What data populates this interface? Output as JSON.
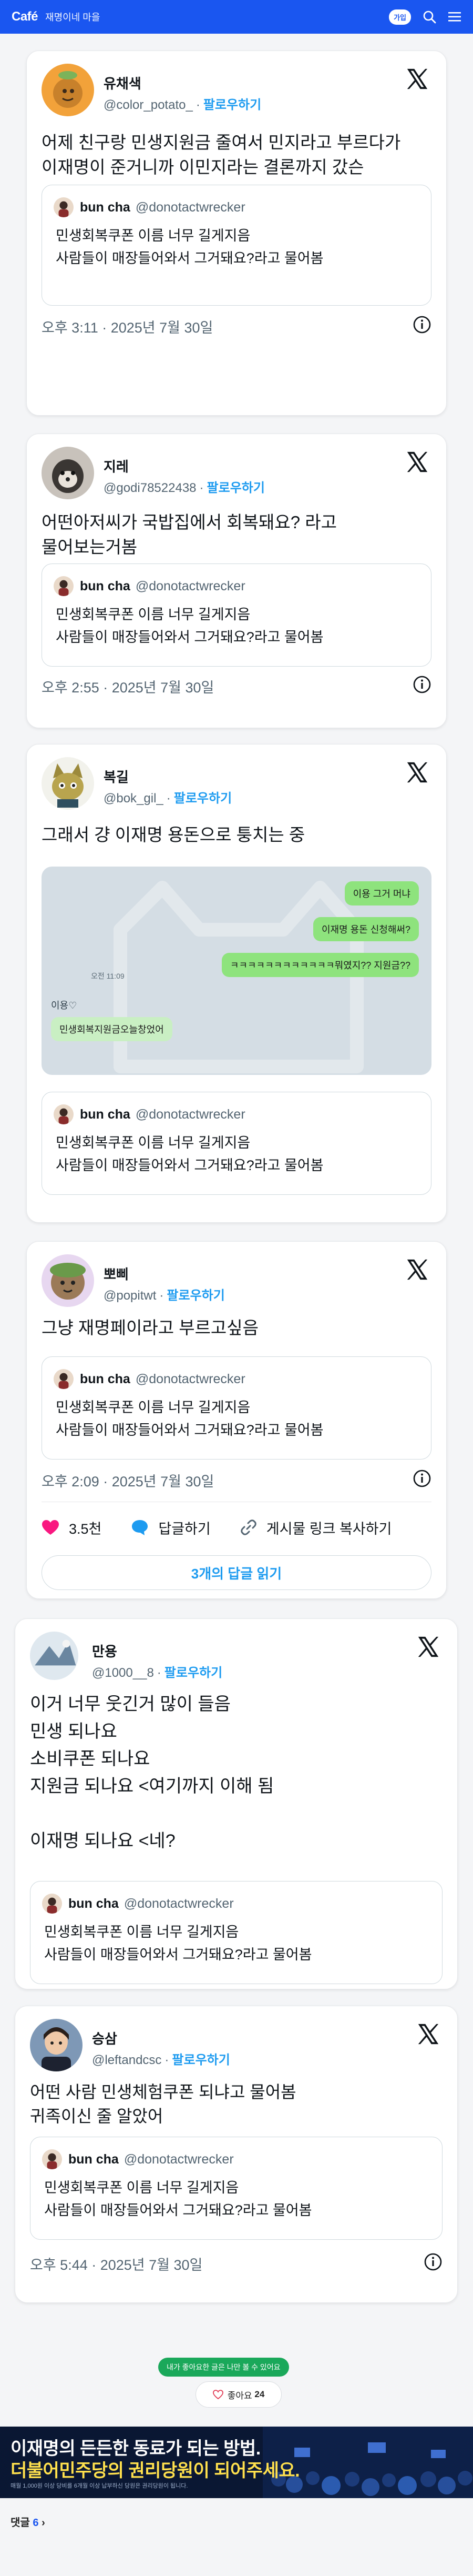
{
  "topbar": {
    "logo": "Café",
    "cafe_name": "재명이네 마을",
    "join_label": "가입"
  },
  "posts": [
    {
      "name": "유채색",
      "handle": "@color_potato_",
      "dot": "·",
      "follow": "팔로우하기",
      "lines": [
        "어제 친구랑 민생지원금 줄여서 민지라고 부르다가",
        "이재명이 준거니까 이민지라는 결론까지 갔슨"
      ],
      "quote": {
        "name": "bun cha",
        "handle": "@donotactwrecker",
        "lines": [
          "민생회복쿠폰 이름 너무 길게지음",
          "사람들이 매장들어와서 그거돼요?라고 물어봄"
        ]
      },
      "meta": "오후 3:11 · 2025년 7월 30일"
    },
    {
      "name": "지레",
      "handle": "@godi78522438",
      "dot": "·",
      "follow": "팔로우하기",
      "lines": [
        "어떤아저씨가 국밥집에서 회복돼요? 라고",
        "물어보는거봄"
      ],
      "quote": {
        "name": "bun cha",
        "handle": "@donotactwrecker",
        "lines": [
          "민생회복쿠폰 이름 너무 길게지음",
          "사람들이 매장들어와서 그거돼요?라고 물어봄"
        ]
      },
      "meta": "오후 2:55 · 2025년 7월 30일"
    },
    {
      "name": "복길",
      "handle": "@bok_gil_",
      "dot": "·",
      "follow": "팔로우하기",
      "lines": [
        "그래서 걍 이재명 용돈으로 퉁치는 중"
      ],
      "chat": {
        "me": [
          "이용 그거 머냐",
          "이재명 용돈 신청해써?",
          "ㅋㅋㅋㅋㅋㅋㅋㅋㅋㅋㅋㅋ뭐였지?? 지원금??"
        ],
        "time": "오전 11:09",
        "sender": "이용♡",
        "you": "민생회복지원금오늘창었어"
      },
      "quote": {
        "name": "bun cha",
        "handle": "@donotactwrecker",
        "lines": [
          "민생회복쿠폰 이름 너무 길게지음",
          "사람들이 매장들어와서 그거돼요?라고 물어봄"
        ]
      }
    },
    {
      "name": "뽀삐",
      "handle": "@popitwt",
      "dot": "·",
      "follow": "팔로우하기",
      "lines": [
        "그냥 재명페이라고 부르고싶음"
      ],
      "quote": {
        "name": "bun cha",
        "handle": "@donotactwrecker",
        "lines": [
          "민생회복쿠폰 이름 너무 길게지음",
          "사람들이 매장들어와서 그거돼요?라고 물어봄"
        ]
      },
      "meta": "오후 2:09 · 2025년 7월 30일",
      "actions": {
        "likes": "3.5천",
        "reply": "답글하기",
        "copy": "게시물 링크 복사하기"
      },
      "read_replies": "3개의 답글 읽기"
    },
    {
      "name": "만용",
      "handle": "@1000__8",
      "dot": "·",
      "follow": "팔로우하기",
      "lines": [
        "이거 너무 웃긴거 많이 들음",
        "민생 되나요",
        "소비쿠폰 되나요",
        "지원금 되나요 <여기까지 이해 됨",
        "",
        "이재명 되나요 <네?"
      ],
      "quote": {
        "name": "bun cha",
        "handle": "@donotactwrecker",
        "lines": [
          "민생회복쿠폰 이름 너무 길게지음",
          "사람들이 매장들어와서 그거돼요?라고 물어봄"
        ]
      }
    },
    {
      "name": "승삼",
      "handle": "@leftandcsc",
      "dot": "·",
      "follow": "팔로우하기",
      "lines": [
        "어떤 사람 민생체험쿠폰 되냐고 물어봄",
        "귀족이신 줄 알았어"
      ],
      "quote": {
        "name": "bun cha",
        "handle": "@donotactwrecker",
        "lines": [
          "민생회복쿠폰 이름 너무 길게지음",
          "사람들이 매장들어와서 그거돼요?라고 물어봄"
        ]
      },
      "meta": "오후 5:44 · 2025년 7월 30일"
    }
  ],
  "like_area": {
    "tooltip": "내가 좋아요한 글은 나만 볼 수 있어요",
    "label": "좋아요",
    "count": "24"
  },
  "banner": {
    "line1": "이재명의 든든한 동료가 되는 방법.",
    "line2": "더불어민주당의 권리당원이 되어주세요.",
    "fine_print": "매월 1,000원 이상 당비를 6개월 이상 납부하신 당원은 권리당원이 됩니다."
  },
  "comments": {
    "label": "댓글",
    "count": "6"
  },
  "colors": {
    "cafe_blue": "#1a56f0",
    "twitter_blue": "#1d9bf0",
    "like_pink": "#f91880",
    "banner_yellow": "#ffe14d"
  }
}
